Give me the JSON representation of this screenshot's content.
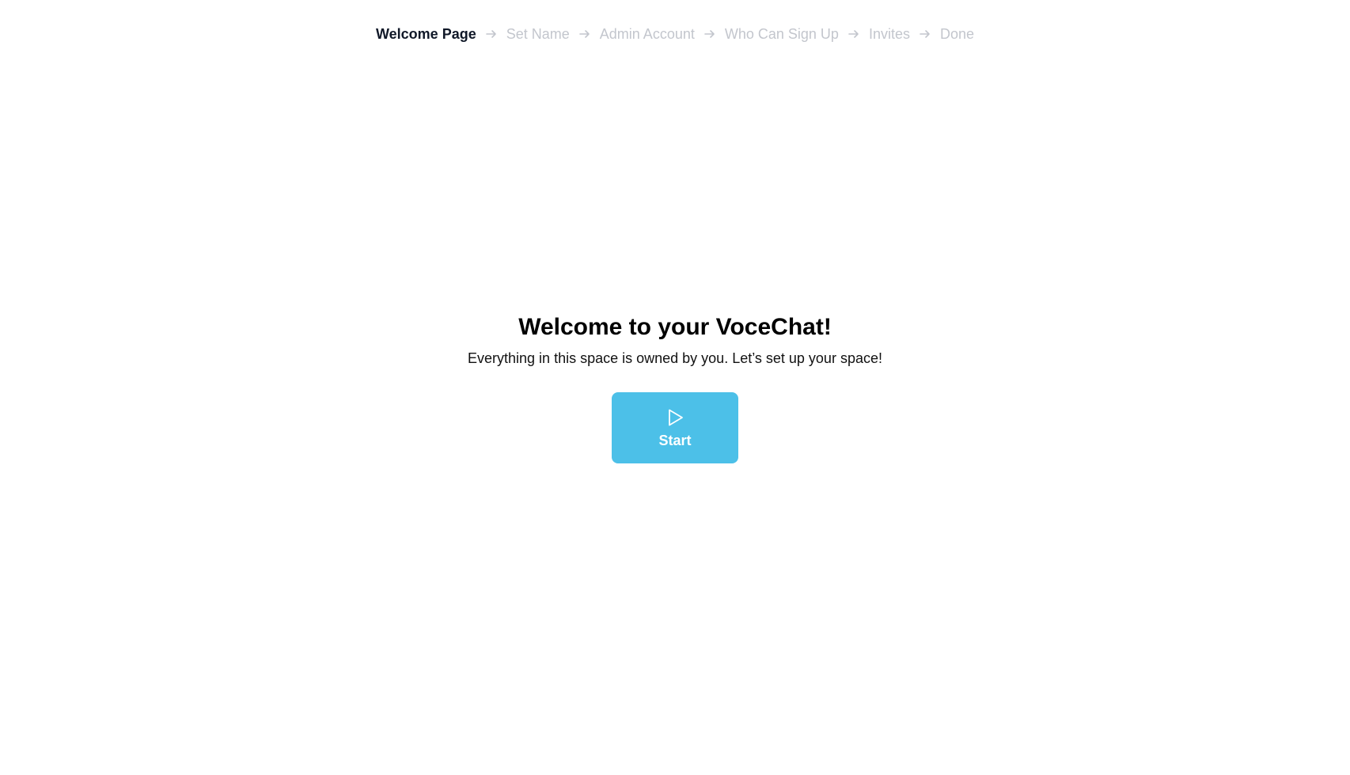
{
  "steps": [
    {
      "label": "Welcome Page",
      "active": true
    },
    {
      "label": "Set Name",
      "active": false
    },
    {
      "label": "Admin Account",
      "active": false
    },
    {
      "label": "Who Can Sign Up",
      "active": false
    },
    {
      "label": "Invites",
      "active": false
    },
    {
      "label": "Done",
      "active": false
    }
  ],
  "step_separator_icon": "arrow-right-icon",
  "hero": {
    "title": "Welcome to your VoceChat!",
    "subtitle": "Everything in this space is owned by you. Let’s set up your space!"
  },
  "start_button": {
    "label": "Start",
    "icon": "play-icon",
    "color": "#4cc0e8"
  },
  "colors": {
    "active_step": "#101828",
    "inactive_step": "#c3c6cd"
  }
}
